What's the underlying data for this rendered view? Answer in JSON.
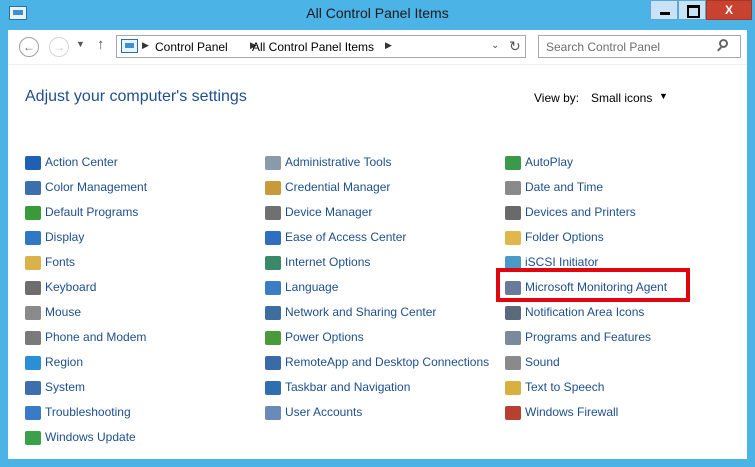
{
  "window": {
    "title": "All Control Panel Items",
    "buttons": {
      "minimize": "",
      "maximize": "",
      "close": "X"
    }
  },
  "nav": {
    "back_glyph": "←",
    "forward_glyph": "→",
    "recent_glyph": "▼",
    "up_glyph": "↑",
    "breadcrumb": [
      "Control Panel",
      "All Control Panel Items"
    ],
    "sep_glyph": "▶",
    "dropdown_glyph": "⌄",
    "refresh_glyph": "↻",
    "search_placeholder": "Search Control Panel"
  },
  "header": {
    "title": "Adjust your computer's settings",
    "view_by_label": "View by:",
    "view_by_value": "Small icons",
    "view_by_arrow": "▼"
  },
  "columns": [
    [
      {
        "label": "Action Center",
        "icon": "flag-icon",
        "color": "#1f5fb4"
      },
      {
        "label": "Color Management",
        "icon": "monitor-color-icon",
        "color": "#3c6fae"
      },
      {
        "label": "Default Programs",
        "icon": "default-programs-icon",
        "color": "#3a9a3a"
      },
      {
        "label": "Display",
        "icon": "display-icon",
        "color": "#2f79c4"
      },
      {
        "label": "Fonts",
        "icon": "fonts-folder-icon",
        "color": "#d9b24a"
      },
      {
        "label": "Keyboard",
        "icon": "keyboard-icon",
        "color": "#6e6e6e"
      },
      {
        "label": "Mouse",
        "icon": "mouse-icon",
        "color": "#8a8a8a"
      },
      {
        "label": "Phone and Modem",
        "icon": "phone-icon",
        "color": "#7a7a7a"
      },
      {
        "label": "Region",
        "icon": "globe-icon",
        "color": "#2b8fd6"
      },
      {
        "label": "System",
        "icon": "system-icon",
        "color": "#3d6fb0"
      },
      {
        "label": "Troubleshooting",
        "icon": "troubleshooting-icon",
        "color": "#3a7bc8"
      },
      {
        "label": "Windows Update",
        "icon": "windows-update-icon",
        "color": "#3aa04a"
      }
    ],
    [
      {
        "label": "Administrative Tools",
        "icon": "admin-tools-icon",
        "color": "#8a9aa8"
      },
      {
        "label": "Credential Manager",
        "icon": "credential-icon",
        "color": "#c89a3c"
      },
      {
        "label": "Device Manager",
        "icon": "device-manager-icon",
        "color": "#707070"
      },
      {
        "label": "Ease of Access Center",
        "icon": "ease-of-access-icon",
        "color": "#2e6fc0"
      },
      {
        "label": "Internet Options",
        "icon": "internet-options-icon",
        "color": "#3a8a6a"
      },
      {
        "label": "Language",
        "icon": "language-icon",
        "color": "#3b7dc4"
      },
      {
        "label": "Network and Sharing Center",
        "icon": "network-icon",
        "color": "#3d6e9e"
      },
      {
        "label": "Power Options",
        "icon": "power-icon",
        "color": "#4a9a3a"
      },
      {
        "label": "RemoteApp and Desktop Connections",
        "icon": "remoteapp-icon",
        "color": "#3a6aa8"
      },
      {
        "label": "Taskbar and Navigation",
        "icon": "taskbar-icon",
        "color": "#2f6fb0"
      },
      {
        "label": "User Accounts",
        "icon": "user-accounts-icon",
        "color": "#6a8ab8"
      }
    ],
    [
      {
        "label": "AutoPlay",
        "icon": "autoplay-icon",
        "color": "#3a9a4a"
      },
      {
        "label": "Date and Time",
        "icon": "clock-icon",
        "color": "#8a8a8a"
      },
      {
        "label": "Devices and Printers",
        "icon": "printer-icon",
        "color": "#6a6a6a"
      },
      {
        "label": "Folder Options",
        "icon": "folder-icon",
        "color": "#e0b74a"
      },
      {
        "label": "iSCSI Initiator",
        "icon": "iscsi-icon",
        "color": "#4a9ac8"
      },
      {
        "label": "Microsoft Monitoring Agent",
        "icon": "monitoring-agent-icon",
        "color": "#6a7a9a"
      },
      {
        "label": "Notification Area Icons",
        "icon": "notification-icon",
        "color": "#5a6a7a"
      },
      {
        "label": "Programs and Features",
        "icon": "programs-features-icon",
        "color": "#7a8a9a"
      },
      {
        "label": "Sound",
        "icon": "speaker-icon",
        "color": "#8a8a8a"
      },
      {
        "label": "Text to Speech",
        "icon": "text-to-speech-icon",
        "color": "#d8b040"
      },
      {
        "label": "Windows Firewall",
        "icon": "firewall-icon",
        "color": "#b84030"
      }
    ]
  ],
  "highlight_color": "#e0050f"
}
